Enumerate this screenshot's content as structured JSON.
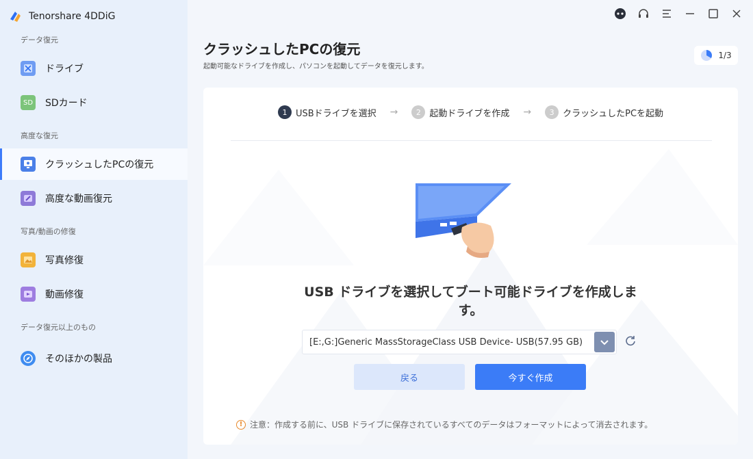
{
  "app": {
    "name": "Tenorshare 4DDiG"
  },
  "sidebar": {
    "sections": [
      {
        "label": "データ復元"
      },
      {
        "label": "高度な復元"
      },
      {
        "label": "写真/動画の修復"
      },
      {
        "label": "データ復元以上のもの"
      }
    ],
    "items": [
      {
        "label": "ドライブ",
        "icon": "drive-icon"
      },
      {
        "label": "SDカード",
        "icon": "sd-card-icon",
        "icon_text": "SD"
      },
      {
        "label": "クラッシュしたPCの復元",
        "icon": "crashed-pc-icon",
        "active": true
      },
      {
        "label": "高度な動画復元",
        "icon": "advanced-video-icon"
      },
      {
        "label": "写真修復",
        "icon": "photo-repair-icon"
      },
      {
        "label": "動画修復",
        "icon": "video-repair-icon"
      },
      {
        "label": "そのほかの製品",
        "icon": "compass-icon"
      }
    ]
  },
  "header": {
    "title": "クラッシュしたPCの復元",
    "subtitle": "起動可能なドライブを作成し、パソコンを起動してデータを復元します。",
    "progress": "1/3",
    "progress_fraction": 0.333
  },
  "steps": [
    {
      "num": "1",
      "label": "USBドライブを選択",
      "active": true
    },
    {
      "num": "2",
      "label": "起動ドライブを作成",
      "active": false
    },
    {
      "num": "3",
      "label": "クラッシュしたPCを起動",
      "active": false
    }
  ],
  "main": {
    "headline_line1": "USB ドライブを選択してブート可能ドライブを作成しま",
    "headline_line2": "す。",
    "drive_value": "[E:,G:]Generic MassStorageClass USB Device- USB(57.95 GB)",
    "back_label": "戻る",
    "create_label": "今すぐ作成",
    "warning": "注意：作成する前に、USB ドライブに保存されているすべてのデータはフォーマットによって消去されます。"
  },
  "colors": {
    "accent": "#3b7cf7",
    "sidebar_bg": "#e8f0fb",
    "warning": "#e8892b"
  }
}
